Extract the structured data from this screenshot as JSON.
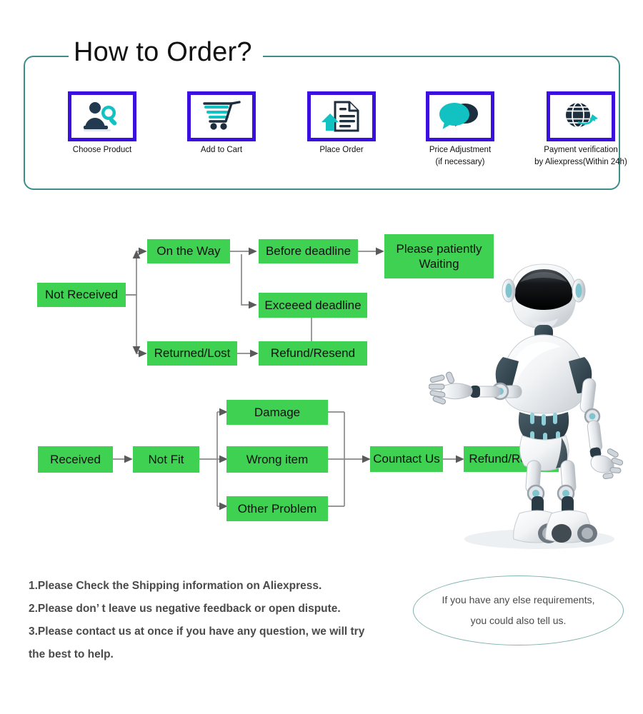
{
  "header": {
    "title": "How to Order?",
    "frame_color": "#3f8d8a"
  },
  "steps": [
    {
      "icon": "person-search-icon",
      "label_line1": "Choose  Product",
      "label_line2": ""
    },
    {
      "icon": "shopping-cart-icon",
      "label_line1": "Add to Cart",
      "label_line2": ""
    },
    {
      "icon": "document-upload-icon",
      "label_line1": "Place  Order",
      "label_line2": ""
    },
    {
      "icon": "speech-bubbles-icon",
      "label_line1": "Price Adjustment",
      "label_line2": "(if necessary)"
    },
    {
      "icon": "globe-refresh-icon",
      "label_line1": "Payment verification",
      "label_line2": "by Aliexpress(Within 24h)"
    }
  ],
  "flow": {
    "node_color": "#3fd152",
    "connector_color": "#8a8a8a",
    "not_received": {
      "root": "Not Received",
      "on_the_way": "On the Way",
      "before_deadline": "Before deadline",
      "please_wait_line1": "Please patiently",
      "please_wait_line2": "Waiting",
      "exceed_deadline": "Exceeed deadline",
      "returned_lost": "Returned/Lost",
      "refund_resend": "Refund/Resend"
    },
    "received": {
      "root": "Received",
      "not_fit": "Not Fit",
      "damage": "Damage",
      "wrong_item": "Wrong item",
      "other_problem": "Other Problem",
      "contact_us": "Countact Us",
      "refund_resend": "Refund/Resend"
    }
  },
  "notes": [
    "1.Please Check the Shipping information on Aliexpress.",
    "2.Please don’ t leave us negative feedback or open dispute.",
    "3.Please contact us at once if you have any question, we will try",
    " the best to help."
  ],
  "bubble": {
    "line1": "If you have any else requirements,",
    "line2": "you could also tell us.",
    "border_color": "#7fb3ae"
  },
  "illustration": {
    "name": "robot-mascot"
  }
}
